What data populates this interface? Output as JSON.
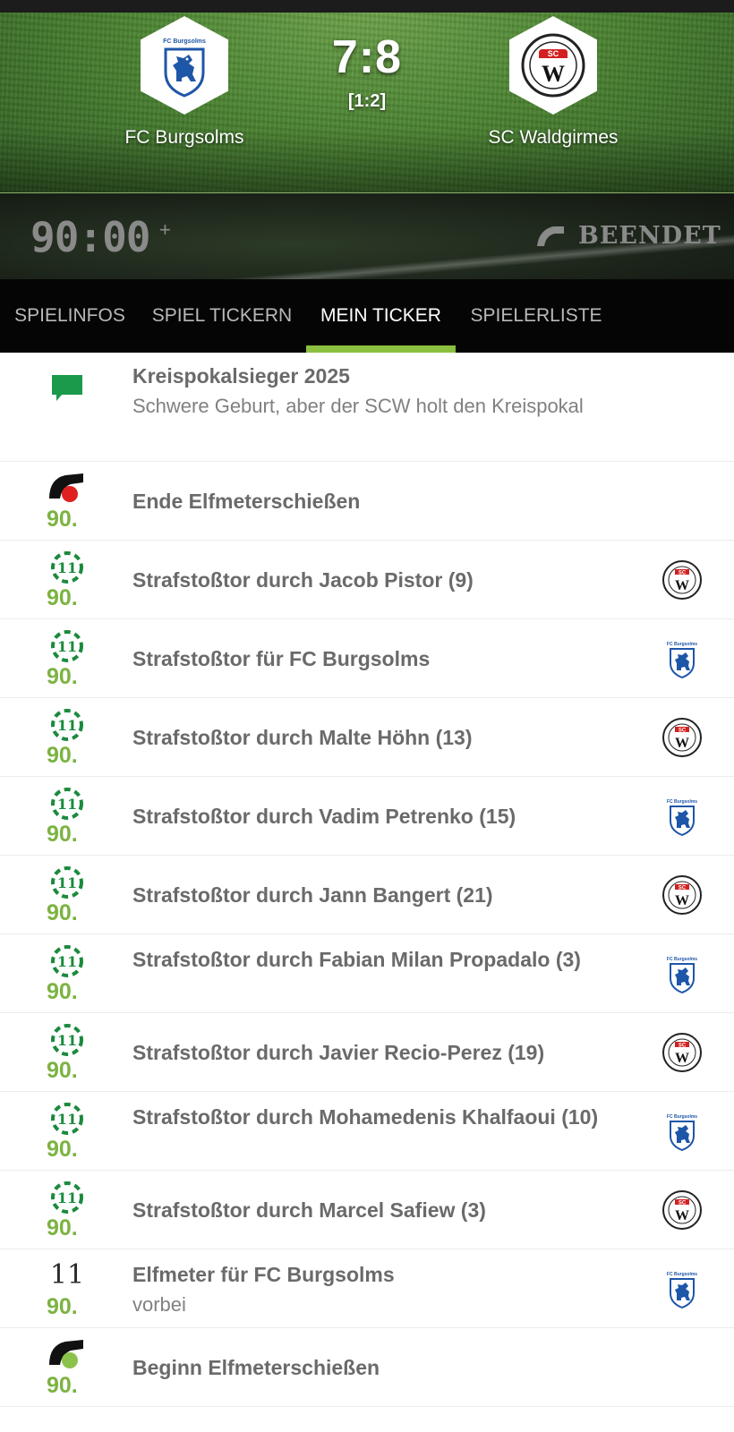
{
  "match": {
    "home_team": "FC Burgsolms",
    "away_team": "SC Waldgirmes",
    "home_crest_text": "FC Burgsolms",
    "away_crest_text": "SC W",
    "score": "7:8",
    "halftime": "[1:2]",
    "clock": "90:00",
    "clock_extra": "+",
    "status": "BEENDET"
  },
  "tabs": [
    {
      "label": "SPIELINFOS",
      "active": false
    },
    {
      "label": "SPIEL TICKERN",
      "active": false
    },
    {
      "label": "MEIN TICKER",
      "active": true
    },
    {
      "label": "SPIELERLISTE",
      "active": false
    }
  ],
  "colors": {
    "accent_green": "#8bbf3f",
    "minute_green": "#7cb342",
    "penalty_icon_green": "#1b8a3d",
    "chat_icon_green": "#1a9a4a",
    "whistle_red": "#e02020",
    "whistle_green": "#8bc34a"
  },
  "events": [
    {
      "icon": "chat-bubble-icon",
      "minute": "",
      "title": "Kreispokalsieger 2025",
      "subtitle": "Schwere Geburt, aber der SCW holt den Kreispokal",
      "team": ""
    },
    {
      "icon": "whistle-end-icon",
      "minute": "90.",
      "title": "Ende Elfmeterschießen",
      "subtitle": "",
      "team": ""
    },
    {
      "icon": "penalty-goal-icon",
      "minute": "90.",
      "title": "Strafstoßtor durch Jacob Pistor (9)",
      "subtitle": "",
      "team": "away"
    },
    {
      "icon": "penalty-goal-icon",
      "minute": "90.",
      "title": "Strafstoßtor für FC Burgsolms",
      "subtitle": "",
      "team": "home"
    },
    {
      "icon": "penalty-goal-icon",
      "minute": "90.",
      "title": "Strafstoßtor durch Malte Höhn (13)",
      "subtitle": "",
      "team": "away"
    },
    {
      "icon": "penalty-goal-icon",
      "minute": "90.",
      "title": "Strafstoßtor durch Vadim Petrenko (15)",
      "subtitle": "",
      "team": "home"
    },
    {
      "icon": "penalty-goal-icon",
      "minute": "90.",
      "title": "Strafstoßtor durch Jann Bangert (21)",
      "subtitle": "",
      "team": "away"
    },
    {
      "icon": "penalty-goal-icon",
      "minute": "90.",
      "title": "Strafstoßtor durch Fabian Milan Propadalo (3)",
      "subtitle": "",
      "team": "home"
    },
    {
      "icon": "penalty-goal-icon",
      "minute": "90.",
      "title": "Strafstoßtor durch Javier Recio-Perez (19)",
      "subtitle": "",
      "team": "away"
    },
    {
      "icon": "penalty-goal-icon",
      "minute": "90.",
      "title": "Strafstoßtor durch Mohamedenis Khalfaoui (10)",
      "subtitle": "",
      "team": "home"
    },
    {
      "icon": "penalty-goal-icon",
      "minute": "90.",
      "title": "Strafstoßtor durch Marcel Safiew (3)",
      "subtitle": "",
      "team": "away"
    },
    {
      "icon": "penalty-miss-icon",
      "icon_text": "11",
      "minute": "90.",
      "title": "Elfmeter für FC Burgsolms",
      "subtitle": "vorbei",
      "team": "home"
    },
    {
      "icon": "whistle-start-icon",
      "minute": "90.",
      "title": "Beginn Elfmeterschießen",
      "subtitle": "",
      "team": ""
    }
  ]
}
